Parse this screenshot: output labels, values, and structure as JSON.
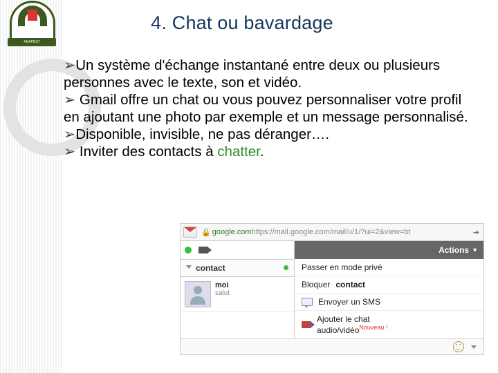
{
  "title": "4. Chat ou bavardage",
  "bullets": [
    {
      "text": "Un système d'échange instantané entre deux ou plusieurs personnes avec le texte, son et vidéo."
    },
    {
      "text": " Gmail  offre un chat ou vous pouvez personnaliser votre profil en ajoutant une photo par exemple et un message personnalisé."
    },
    {
      "text": "Disponible, invisible, ne pas déranger…."
    },
    {
      "prefix": " Inviter des contacts à ",
      "highlight": "chatter",
      "suffix": "."
    }
  ],
  "gmail": {
    "url_host": "google.com",
    "url_path": " https://mail.google.com/mail/u/1/?ui=2&view=bt",
    "contact_header": "contact",
    "user_name": "moi",
    "user_status": "salut",
    "actions_label": "Actions",
    "menu": {
      "private": "Passer en mode privé",
      "block_prefix": "Bloquer ",
      "block_target": "contact",
      "sms": "Envoyer un SMS",
      "av_line1": "Ajouter le chat",
      "av_line2": "audio/vidéo",
      "nouveau": "Nouveau !"
    }
  },
  "logo_banner": "ANAPEST"
}
